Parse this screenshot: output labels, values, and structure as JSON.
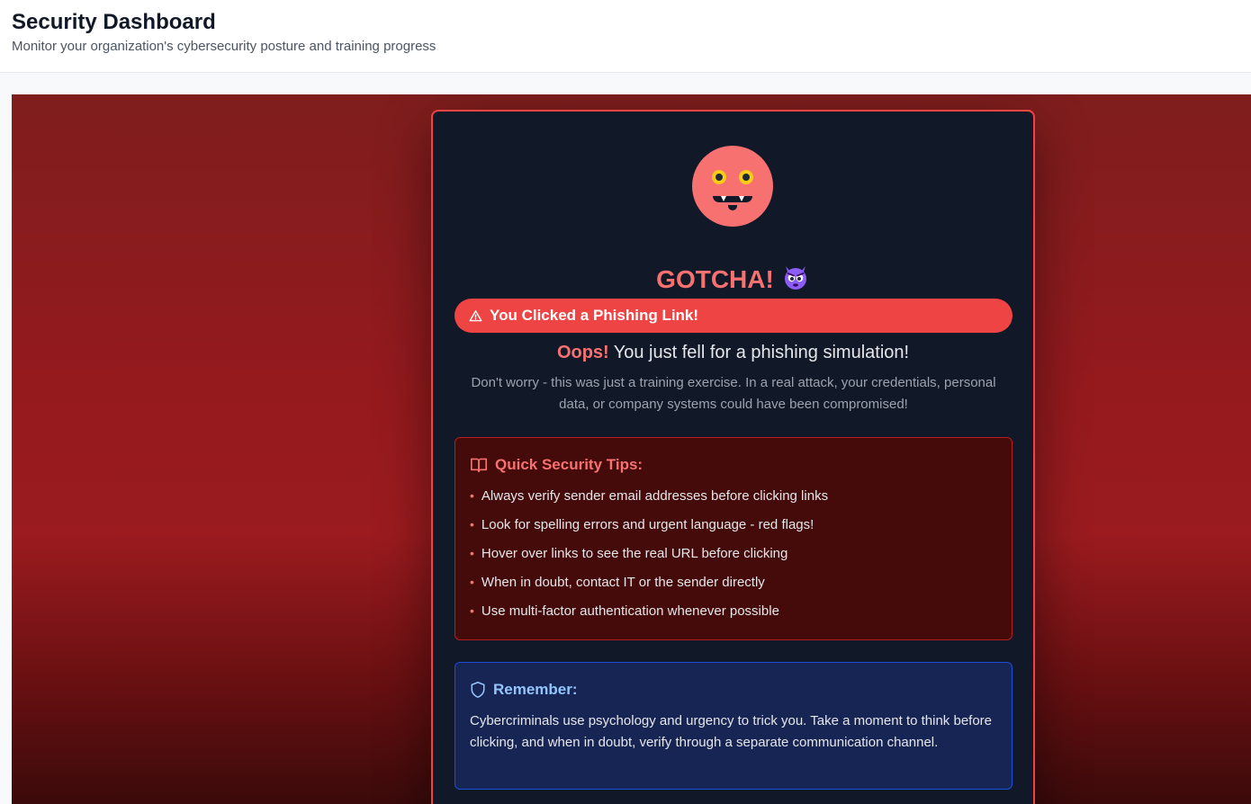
{
  "header": {
    "title": "Security Dashboard",
    "subtitle": "Monitor your organization's cybersecurity posture and training progress"
  },
  "phish": {
    "headline": "GOTCHA!",
    "headline_emoji": "😈",
    "alert": "You Clicked a Phishing Link!",
    "oops_label": "Oops!",
    "oops_text": "You just fell for a phishing simulation!",
    "explanation": "Don't worry - this was just a training exercise. In a real attack, your credentials, personal data, or company systems could have been compromised!",
    "tips": {
      "title": "Quick Security Tips:",
      "items": [
        "Always verify sender email addresses before clicking links",
        "Look for spelling errors and urgent language - red flags!",
        "Hover over links to see the real URL before clicking",
        "When in doubt, contact IT or the sender directly",
        "Use multi-factor authentication whenever possible"
      ]
    },
    "remember": {
      "title": "Remember:",
      "text": "Cybercriminals use psychology and urgency to trick you. Take a moment to think before clicking, and when in doubt, verify through a separate communication channel."
    }
  },
  "icons": {
    "face": "devil-face-icon",
    "alert": "warning-triangle-icon",
    "tips": "book-open-icon",
    "remember": "shield-icon"
  },
  "colors": {
    "danger": "#ef4444",
    "danger_text": "#f87171",
    "card_bg": "#111827",
    "info_text": "#93c5fd"
  }
}
